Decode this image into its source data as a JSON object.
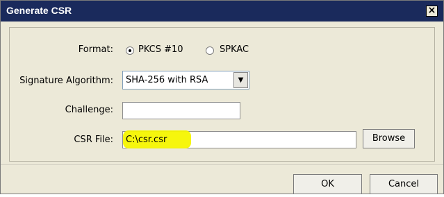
{
  "window": {
    "title": "Generate CSR",
    "close_label": "×"
  },
  "form": {
    "format_label": "Format:",
    "format_options": [
      "PKCS #10",
      "SPKAC"
    ],
    "format_selected": "PKCS #10",
    "signature_label": "Signature Algorithm:",
    "signature_value": "SHA-256 with RSA",
    "challenge_label": "Challenge:",
    "challenge_value": "",
    "csr_label": "CSR File:",
    "csr_value": "C:\\csr.csr",
    "browse_label": "Browse"
  },
  "buttons": {
    "ok_label": "OK",
    "cancel_label": "Cancel"
  },
  "icons": {
    "dropdown": "chevron-down-icon",
    "close": "close-icon"
  },
  "colors": {
    "titlebar": "#1a2a5c",
    "highlight": "#f6f600"
  }
}
